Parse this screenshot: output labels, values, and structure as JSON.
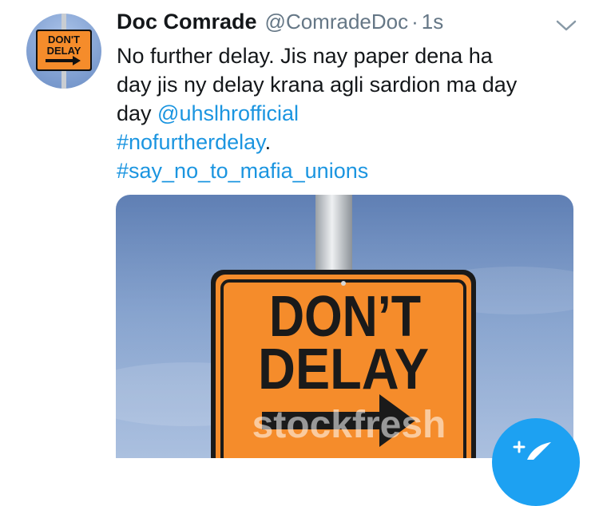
{
  "tweet": {
    "author_name": "Doc Comrade",
    "handle": "@ComradeDoc",
    "separator": "·",
    "time": "1s",
    "text_lines": [
      "No further delay. Jis nay paper dena ha",
      "day jis ny delay krana agli sardion ma day",
      "day "
    ],
    "mention": "@uhslhrofficial",
    "hashtag_1": "#nofurtherdelay",
    "hashtag_1_suffix": ".",
    "hashtag_2": "#say_no_to_mafia_unions"
  },
  "avatar": {
    "sign_line1": "DON'T",
    "sign_line2": "DELAY"
  },
  "media": {
    "sign_line1": "DON’T",
    "sign_line2": "DELAY",
    "watermark": "stockfresh"
  },
  "icons": {
    "more": "chevron-down-icon",
    "compose": "compose-tweet-icon"
  },
  "colors": {
    "link": "#1b95e0",
    "sign_orange": "#f58c2b",
    "sky": "#7898c8",
    "fab": "#1da1f2"
  }
}
